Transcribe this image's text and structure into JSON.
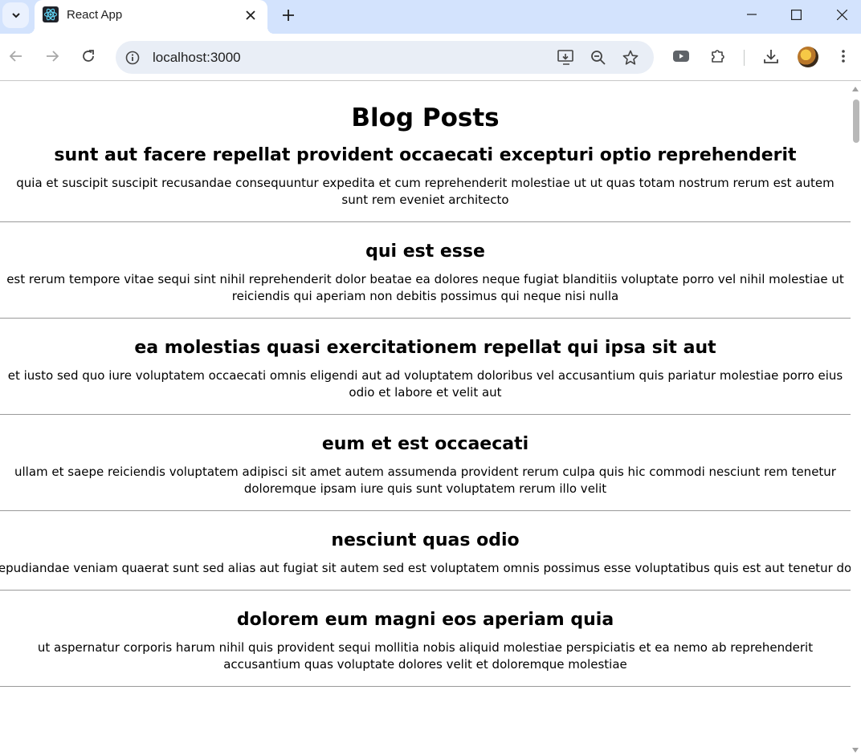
{
  "browser": {
    "tab_title": "React App",
    "url": "localhost:3000"
  },
  "icons": {
    "tab_search": "chevron-down-icon",
    "favicon": "react-logo-icon",
    "close": "close-icon",
    "new_tab": "plus-icon",
    "minimize": "minimize-icon",
    "maximize": "maximize-icon",
    "window_close": "window-close-icon",
    "back": "back-arrow-icon",
    "forward": "forward-arrow-icon",
    "reload": "reload-icon",
    "site_info": "info-icon",
    "install": "install-app-icon",
    "zoom": "zoom-out-icon",
    "bookmark": "star-icon",
    "media": "media-icon",
    "extensions": "puzzle-icon",
    "downloads": "download-icon",
    "menu": "kebab-menu-icon"
  },
  "colors": {
    "tabstrip": "#d3e3fd",
    "omnibox": "#e9eef6",
    "divider": "#9a9a9a"
  },
  "page": {
    "title": "Blog Posts",
    "posts": [
      {
        "title": "sunt aut facere repellat provident occaecati excepturi optio reprehenderit",
        "body": "quia et suscipit suscipit recusandae consequuntur expedita et cum reprehenderit molestiae ut ut quas totam nostrum rerum est autem sunt rem eveniet architecto"
      },
      {
        "title": "qui est esse",
        "body": "est rerum tempore vitae sequi sint nihil reprehenderit dolor beatae ea dolores neque fugiat blanditiis voluptate porro vel nihil molestiae ut reiciendis qui aperiam non debitis possimus qui neque nisi nulla"
      },
      {
        "title": "ea molestias quasi exercitationem repellat qui ipsa sit aut",
        "body": "et iusto sed quo iure voluptatem occaecati omnis eligendi aut ad voluptatem doloribus vel accusantium quis pariatur molestiae porro eius odio et labore et velit aut"
      },
      {
        "title": "eum et est occaecati",
        "body": "ullam et saepe reiciendis voluptatem adipisci sit amet autem assumenda provident rerum culpa quis hic commodi nesciunt rem tenetur doloremque ipsam iure quis sunt voluptatem rerum illo velit"
      },
      {
        "title": "nesciunt quas odio",
        "body": "repudiandae veniam quaerat sunt sed alias aut fugiat sit autem sed est voluptatem omnis possimus esse voluptatibus quis est aut tenetur dolor neque"
      },
      {
        "title": "dolorem eum magni eos aperiam quia",
        "body": "ut aspernatur corporis harum nihil quis provident sequi mollitia nobis aliquid molestiae perspiciatis et ea nemo ab reprehenderit accusantium quas voluptate dolores velit et doloremque molestiae"
      }
    ]
  }
}
